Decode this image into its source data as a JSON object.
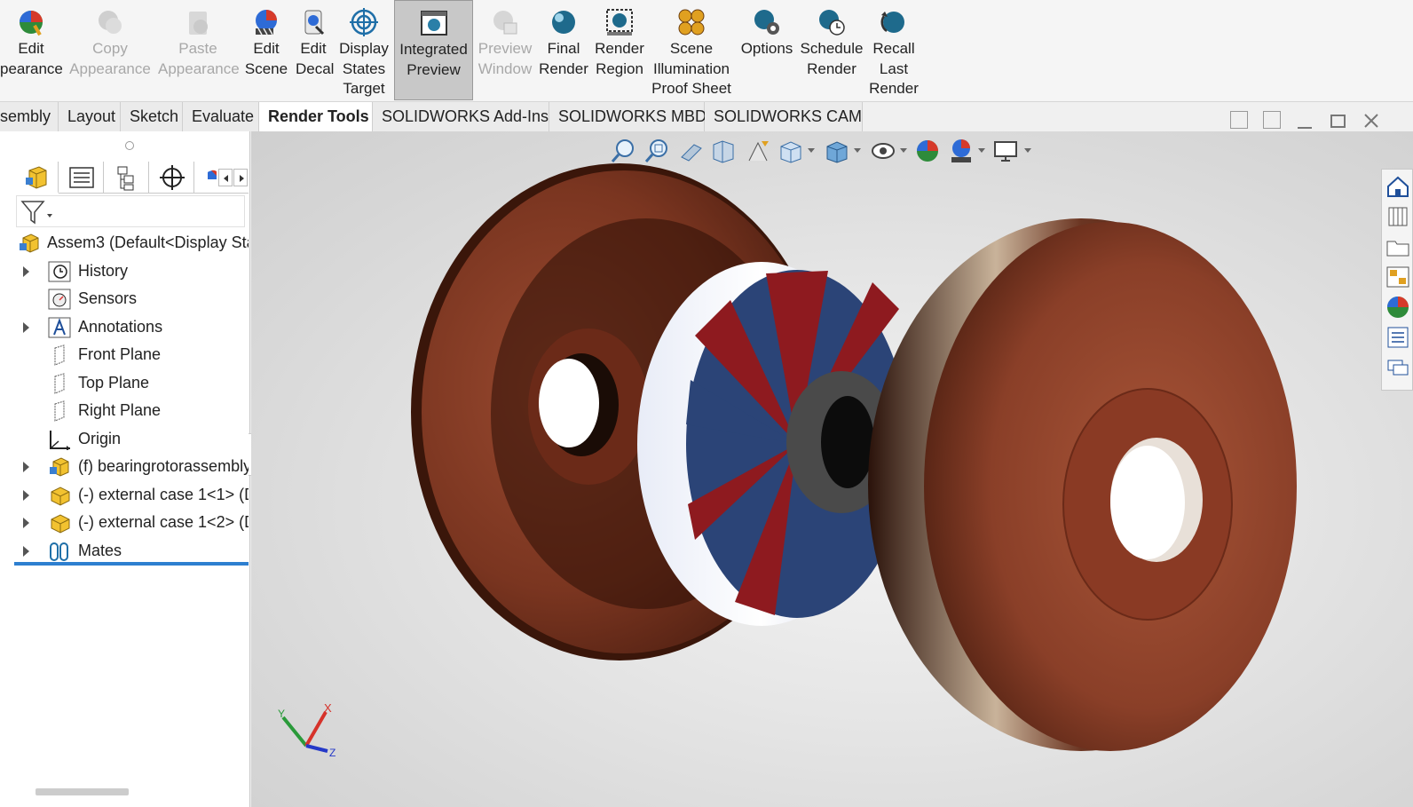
{
  "ribbon": {
    "buttons": [
      {
        "lines": [
          "Edit",
          "pearance"
        ],
        "icon": "edit-appearance-icon",
        "state": "normal"
      },
      {
        "lines": [
          "Copy",
          "Appearance"
        ],
        "icon": "copy-appearance-icon",
        "state": "disabled"
      },
      {
        "lines": [
          "Paste",
          "Appearance"
        ],
        "icon": "paste-appearance-icon",
        "state": "disabled"
      },
      {
        "lines": [
          "Edit",
          "Scene"
        ],
        "icon": "edit-scene-icon",
        "state": "normal"
      },
      {
        "lines": [
          "Edit",
          "Decal"
        ],
        "icon": "edit-decal-icon",
        "state": "normal"
      },
      {
        "lines": [
          "Display",
          "States",
          "Target"
        ],
        "icon": "display-states-target-icon",
        "state": "normal"
      },
      {
        "lines": [
          "Integrated",
          "Preview"
        ],
        "icon": "integrated-preview-icon",
        "state": "active"
      },
      {
        "lines": [
          "Preview",
          "Window"
        ],
        "icon": "preview-window-icon",
        "state": "disabled"
      },
      {
        "lines": [
          "Final",
          "Render"
        ],
        "icon": "final-render-icon",
        "state": "normal"
      },
      {
        "lines": [
          "Render",
          "Region"
        ],
        "icon": "render-region-icon",
        "state": "normal"
      },
      {
        "lines": [
          "Scene",
          "Illumination",
          "Proof Sheet"
        ],
        "icon": "scene-illumination-icon",
        "state": "normal"
      },
      {
        "lines": [
          "Options"
        ],
        "icon": "options-icon",
        "state": "normal"
      },
      {
        "lines": [
          "Schedule",
          "Render"
        ],
        "icon": "schedule-render-icon",
        "state": "normal"
      },
      {
        "lines": [
          "Recall",
          "Last",
          "Render"
        ],
        "icon": "recall-last-render-icon",
        "state": "normal"
      }
    ]
  },
  "tabs": [
    {
      "label": "sembly",
      "selected": false
    },
    {
      "label": "Layout",
      "selected": false
    },
    {
      "label": "Sketch",
      "selected": false
    },
    {
      "label": "Evaluate",
      "selected": false
    },
    {
      "label": "Render Tools",
      "selected": true
    },
    {
      "label": "SOLIDWORKS Add-Ins",
      "selected": false
    },
    {
      "label": "SOLIDWORKS MBD",
      "selected": false
    },
    {
      "label": "SOLIDWORKS CAM",
      "selected": false
    }
  ],
  "tree": {
    "root": "Assem3  (Default<Display Sta",
    "items": [
      {
        "label": "History",
        "expandable": true,
        "icon": "history-icon"
      },
      {
        "label": "Sensors",
        "expandable": false,
        "icon": "sensors-icon"
      },
      {
        "label": "Annotations",
        "expandable": true,
        "icon": "annotations-icon"
      },
      {
        "label": "Front Plane",
        "expandable": false,
        "icon": "plane-icon"
      },
      {
        "label": "Top Plane",
        "expandable": false,
        "icon": "plane-icon"
      },
      {
        "label": "Right Plane",
        "expandable": false,
        "icon": "plane-icon"
      },
      {
        "label": "Origin",
        "expandable": false,
        "icon": "origin-icon"
      },
      {
        "label": "(f) bearingrotorassembly",
        "expandable": true,
        "icon": "assembly-icon"
      },
      {
        "label": "(-) external case 1<1> (D",
        "expandable": true,
        "icon": "part-icon"
      },
      {
        "label": "(-) external case 1<2> (D",
        "expandable": true,
        "icon": "part-icon"
      },
      {
        "label": "Mates",
        "expandable": true,
        "icon": "mates-icon"
      }
    ]
  },
  "triad": {
    "x": "X",
    "y": "Y",
    "z": "Z"
  },
  "colors": {
    "accent": "#2d7fd0",
    "copper": "#8a3f28",
    "rotor_red": "#8e1a1f",
    "rotor_blue": "#2b4477"
  }
}
